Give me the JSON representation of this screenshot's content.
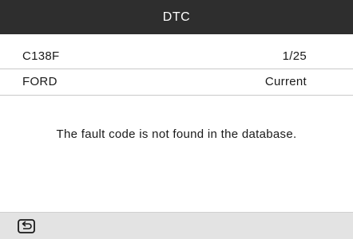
{
  "header": {
    "title": "DTC"
  },
  "dtc": {
    "code": "C138F",
    "position": "1/25",
    "make": "FORD",
    "status": "Current"
  },
  "message": "The fault code is not found in the database.",
  "footer": {
    "back_icon": "back-icon"
  },
  "colors": {
    "title_bar": "#2e2e2e",
    "bottom_bar": "#e3e3e3",
    "text": "#1a1a1a"
  }
}
